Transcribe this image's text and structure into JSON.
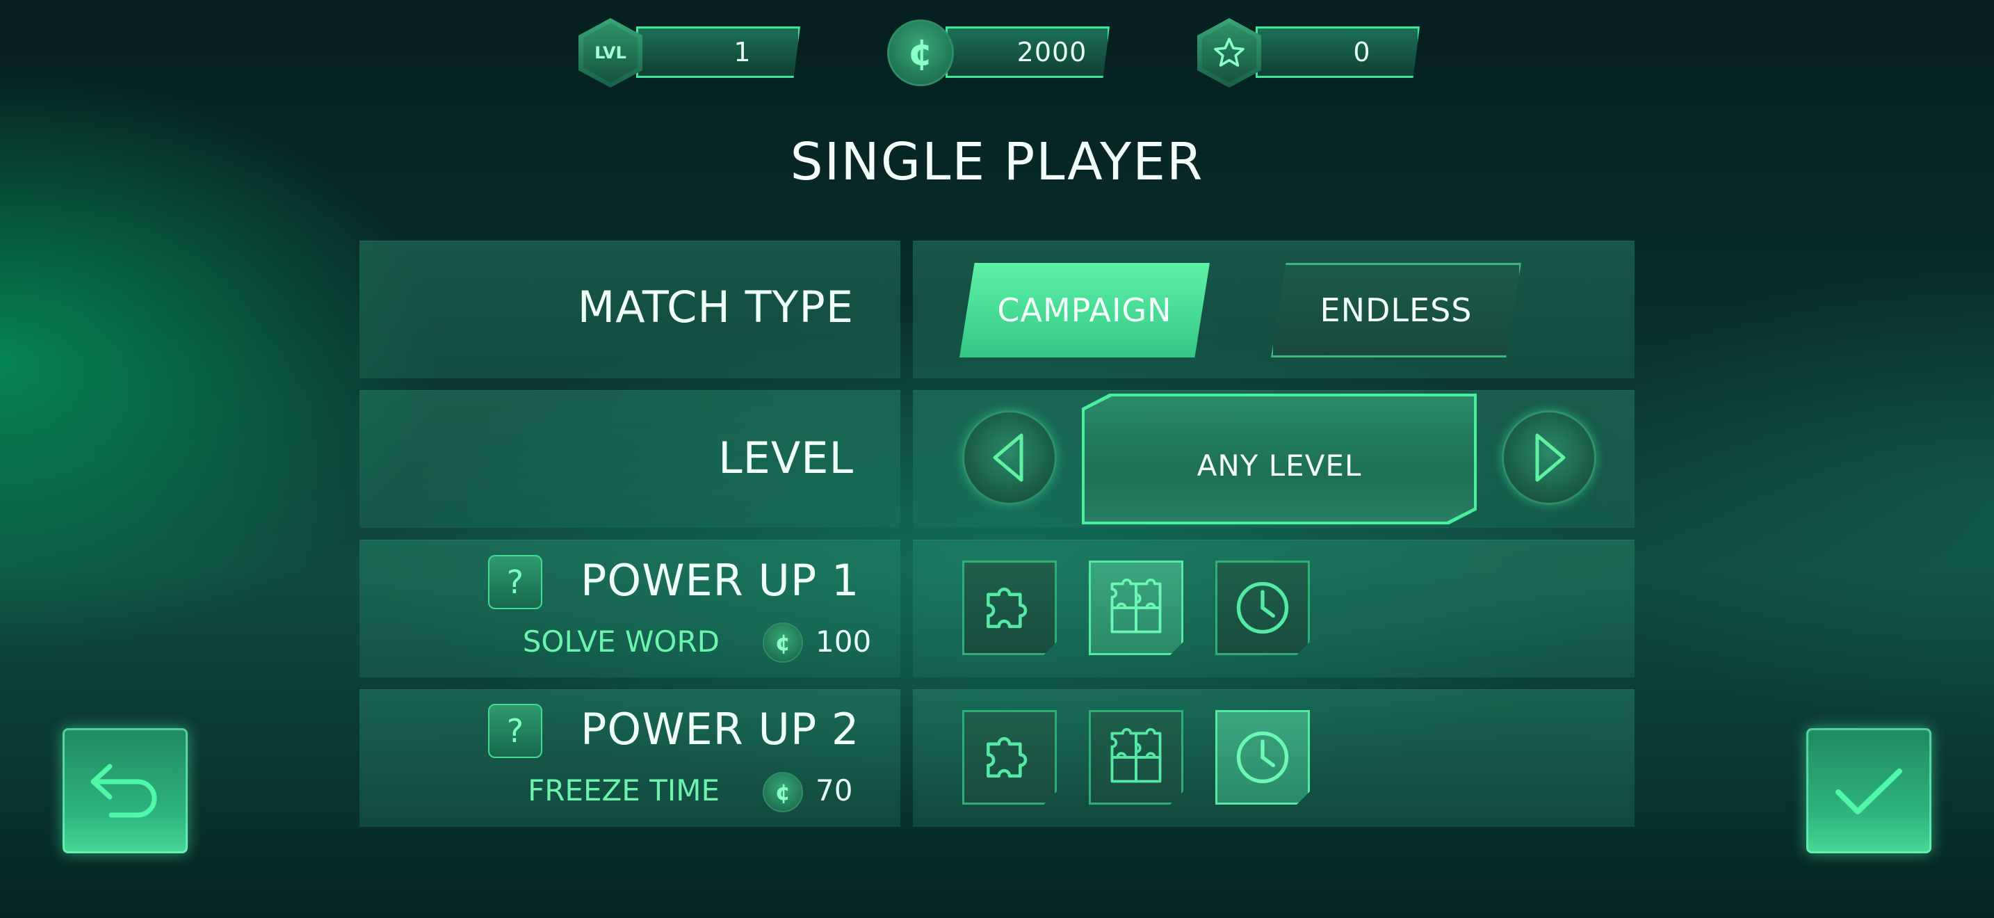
{
  "top_bar": {
    "level": {
      "badge": "LVL",
      "value": "1"
    },
    "coins": {
      "badge": "¢",
      "value": "2000"
    },
    "stars": {
      "value": "0"
    }
  },
  "title": "SINGLE PLAYER",
  "match_type": {
    "label": "MATCH TYPE",
    "options": [
      "CAMPAIGN",
      "ENDLESS"
    ],
    "selected": "CAMPAIGN"
  },
  "level": {
    "label": "LEVEL",
    "value": "ANY LEVEL"
  },
  "power_ups": [
    {
      "label": "POWER UP 1",
      "help": "?",
      "name": "SOLVE WORD",
      "coin": "¢",
      "cost": "100",
      "selected_icon": "puzzle-multi-icon"
    },
    {
      "label": "POWER UP 2",
      "help": "?",
      "name": "FREEZE TIME",
      "coin": "¢",
      "cost": "70",
      "selected_icon": "clock-icon"
    }
  ],
  "power_up_icons": [
    "puzzle-piece-icon",
    "puzzle-multi-icon",
    "clock-icon"
  ],
  "actions": {
    "back_icon": "back-arrow-icon",
    "confirm_icon": "checkmark-icon"
  },
  "colors": {
    "accent": "#4ef0a2",
    "accent_dark": "#1d6f55",
    "background": "#0a2e2d"
  }
}
